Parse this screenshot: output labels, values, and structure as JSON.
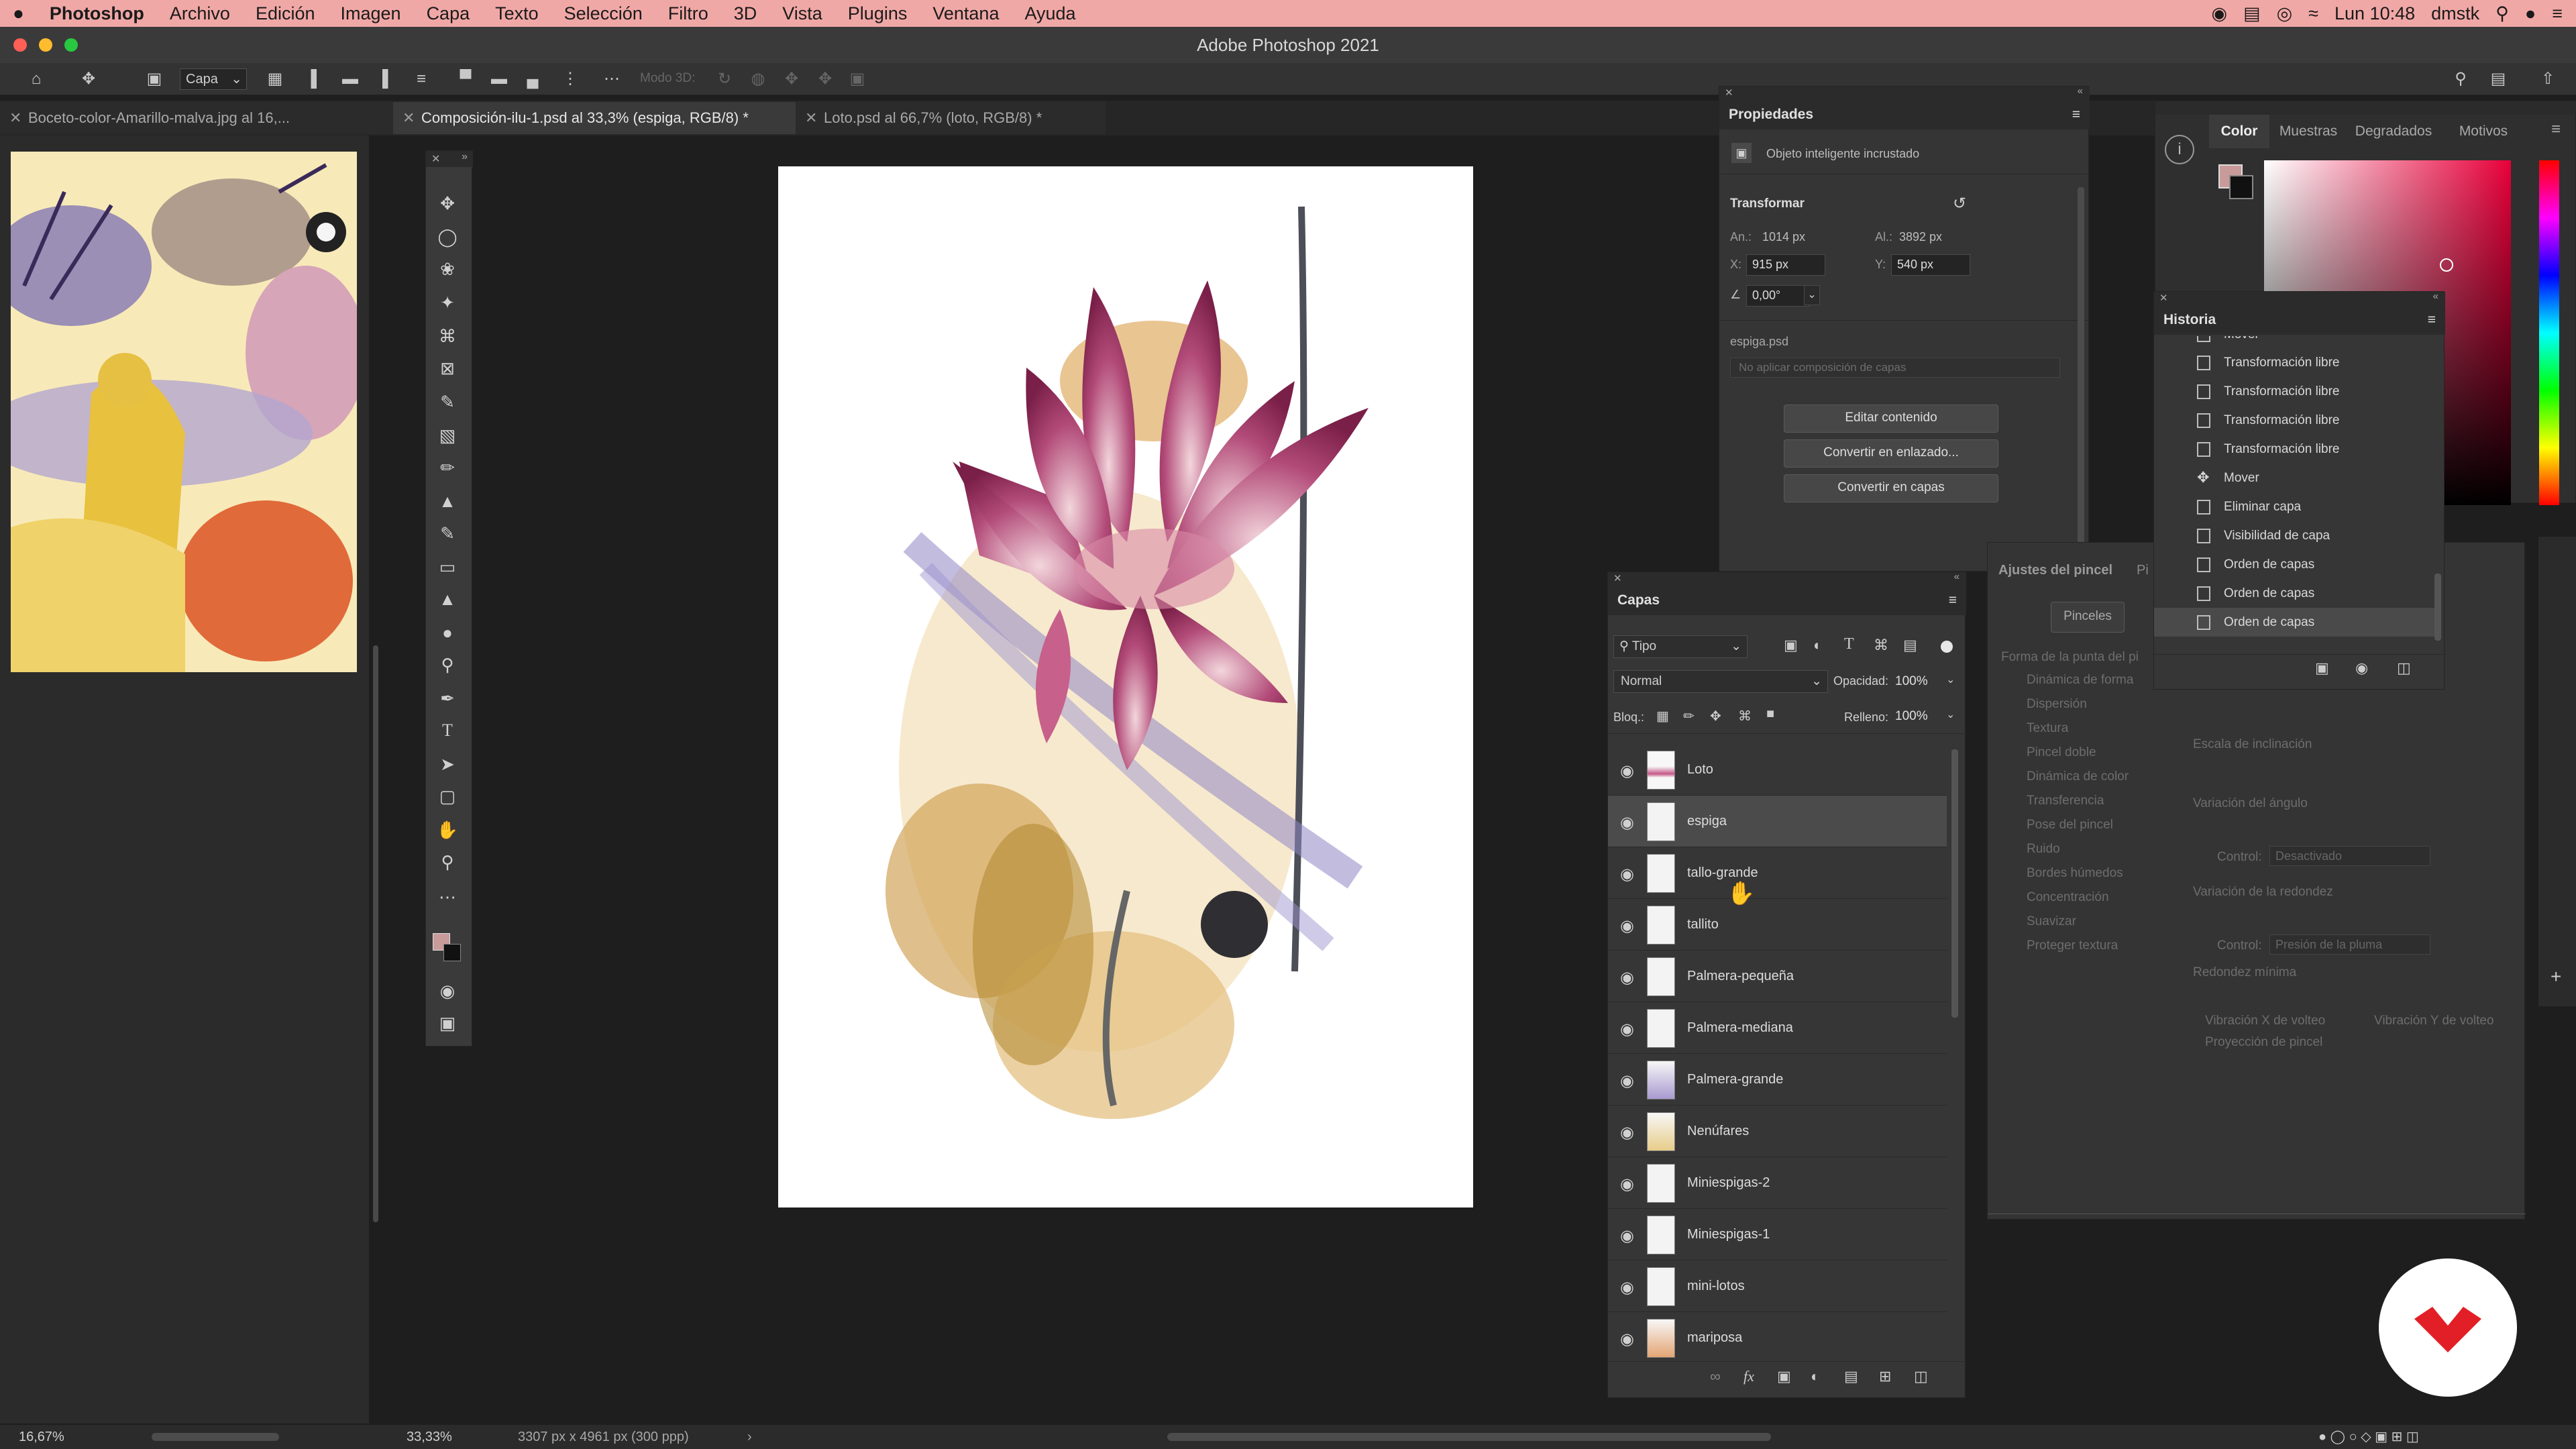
{
  "menubar": {
    "apple": "",
    "app": "Photoshop",
    "items": [
      "Archivo",
      "Edición",
      "Imagen",
      "Capa",
      "Texto",
      "Selección",
      "Filtro",
      "3D",
      "Vista",
      "Plugins",
      "Ventana",
      "Ayuda"
    ],
    "clock": "Lun 10:48",
    "user": "dmstk"
  },
  "window": {
    "title": "Adobe Photoshop 2021"
  },
  "options": {
    "layer_select": "Capa",
    "mode3d": "Modo 3D:"
  },
  "tabs": [
    {
      "label": "Boceto-color-Amarillo-malva.jpg al 16,..."
    },
    {
      "label": "Composición-ilu-1.psd al 33,3% (espiga, RGB/8) *"
    },
    {
      "label": "Loto.psd al 66,7% (loto, RGB/8) *"
    }
  ],
  "properties": {
    "title": "Propiedades",
    "type": "Objeto inteligente incrustado",
    "transform": "Transformar",
    "an_label": "An.:",
    "an": "1014 px",
    "al_label": "Al.:",
    "al": "3892 px",
    "x_label": "X:",
    "x": "915 px",
    "y_label": "Y:",
    "y": "540 px",
    "angle": "0,00°",
    "file": "espiga.psd",
    "comp": "No aplicar composición de capas",
    "btn_edit": "Editar contenido",
    "btn_link": "Convertir en enlazado...",
    "btn_layers": "Convertir en capas"
  },
  "color_panel": {
    "tabs": [
      "Color",
      "Muestras",
      "Degradados",
      "Motivos"
    ]
  },
  "history": {
    "title": "Historia",
    "items": [
      "Mover",
      "Transformación libre",
      "Transformación libre",
      "Transformación libre",
      "Transformación libre",
      "Mover",
      "Eliminar capa",
      "Visibilidad de capa",
      "Orden de capas",
      "Orden de capas",
      "Orden de capas"
    ]
  },
  "layers": {
    "title": "Capas",
    "filter": "Tipo",
    "blend": "Normal",
    "opacity_label": "Opacidad:",
    "opacity": "100%",
    "lock_label": "Bloq.:",
    "fill_label": "Relleno:",
    "fill": "100%",
    "items": [
      "Loto",
      "espiga",
      "tallo-grande",
      "tallito",
      "Palmera-pequeña",
      "Palmera-mediana",
      "Palmera-grande",
      "Nenúfares",
      "Miniespigas-2",
      "Miniespigas-1",
      "mini-lotos",
      "mariposa"
    ]
  },
  "brush": {
    "title": "Ajustes del pincel",
    "tab2": "Pi",
    "pinceles": "Pinceles",
    "tip": "Forma de la punta del pi",
    "options": [
      "Dinámica de forma",
      "Dispersión",
      "Textura",
      "Pincel doble",
      "Dinámica de color",
      "Transferencia",
      "Pose del pincel",
      "Ruido",
      "Bordes húmedos",
      "Concentración",
      "Suavizar",
      "Proteger textura"
    ],
    "scale": "Escala de inclinación",
    "angle_var": "Variación del ángulo",
    "control1_label": "Control:",
    "control1": "Desactivado",
    "round_var": "Variación de la redondez",
    "control2_label": "Control:",
    "control2": "Presión de la pluma",
    "round_min": "Redondez mínima",
    "flipx": "Vibración X de volteo",
    "flipy": "Vibración Y de volteo",
    "proj": "Proyección de pincel"
  },
  "status": {
    "left_zoom": "16,67%",
    "zoom": "33,33%",
    "doc": "3307 px x 4961 px (300 ppp)"
  }
}
